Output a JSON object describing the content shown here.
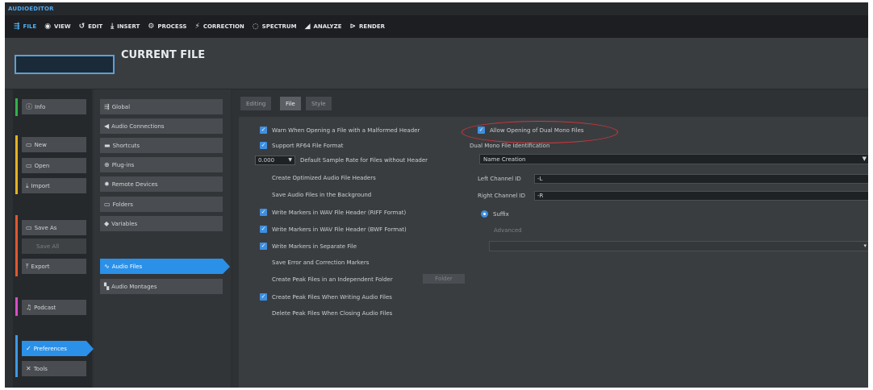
{
  "app": {
    "title": "AUDIOEDITOR"
  },
  "menu": [
    {
      "icon": "⇶",
      "label": "FILE"
    },
    {
      "icon": "◉",
      "label": "VIEW"
    },
    {
      "icon": "↺",
      "label": "EDIT"
    },
    {
      "icon": "⤓",
      "label": "INSERT"
    },
    {
      "icon": "⚙",
      "label": "PROCESS"
    },
    {
      "icon": "⚡",
      "label": "CORRECTION"
    },
    {
      "icon": "◌",
      "label": "SPECTRUM"
    },
    {
      "icon": "◢",
      "label": "ANALYZE"
    },
    {
      "icon": "⊳",
      "label": "RENDER"
    }
  ],
  "header": {
    "title": "CURRENT FILE"
  },
  "sidebar": {
    "info": {
      "icon": "ⓘ",
      "label": "Info"
    },
    "new": {
      "icon": "▭",
      "label": "New"
    },
    "open": {
      "icon": "▭",
      "label": "Open"
    },
    "import": {
      "icon": "⤓",
      "label": "Import"
    },
    "save_as": {
      "icon": "▭",
      "label": "Save As"
    },
    "save_all": {
      "label": "Save All"
    },
    "export": {
      "icon": "⤒",
      "label": "Export"
    },
    "podcast": {
      "icon": "♫",
      "label": "Podcast"
    },
    "preferences": {
      "icon": "✓",
      "label": "Preferences"
    },
    "tools": {
      "icon": "✕",
      "label": "Tools"
    }
  },
  "accent_colors": {
    "info": "#35b04a",
    "new_group": "#e5b323",
    "save_group": "#e0582e",
    "podcast": "#d84fc6",
    "preferences": "#3c9be8"
  },
  "categories": {
    "global": {
      "icon": "⇶",
      "label": "Global"
    },
    "audio_connections": {
      "icon": "◀",
      "label": "Audio Connections"
    },
    "shortcuts": {
      "icon": "▬",
      "label": "Shortcuts"
    },
    "plug_ins": {
      "icon": "⊕",
      "label": "Plug-ins"
    },
    "remote_devices": {
      "icon": "✹",
      "label": "Remote Devices"
    },
    "folders": {
      "icon": "▭",
      "label": "Folders"
    },
    "variables": {
      "icon": "◆",
      "label": "Variables"
    },
    "audio_files": {
      "icon": "∿",
      "label": "Audio Files"
    },
    "audio_montages": {
      "icon": "▚",
      "label": "Audio Montages"
    }
  },
  "tabs": [
    "Editing",
    "File",
    "Style"
  ],
  "options": {
    "warn_malformed": "Warn When Opening a File with a Malformed Header",
    "support_rf64": "Support RF64 File Format",
    "default_sample_rate_value": "0.000",
    "default_sample_rate": "Default Sample Rate for Files without Header",
    "create_optimized": "Create Optimized Audio File Headers",
    "save_background": "Save Audio Files in the Background",
    "write_markers_riff": "Write Markers in WAV File Header (RIFF Format)",
    "write_markers_bwf": "Write Markers in WAV File Header (BWF Format)",
    "write_markers_separate": "Write Markers in Separate File",
    "save_error_markers": "Save Error and Correction Markers",
    "create_peak_independent": "Create Peak Files in an Independent Folder",
    "folder_button": "Folder",
    "create_peak_writing": "Create Peak Files When Writing Audio Files",
    "delete_peak_closing": "Delete Peak Files When Closing Audio Files"
  },
  "dual_mono": {
    "allow": "Allow Opening of Dual Mono Files",
    "identification_label": "Dual Mono File Identification",
    "identification_value": "Name Creation",
    "left_label": "Left Channel ID",
    "left_value": "-L",
    "right_label": "Right Channel ID",
    "right_value": "-R",
    "suffix_label": "Suffix",
    "advanced_label": "Advanced"
  }
}
